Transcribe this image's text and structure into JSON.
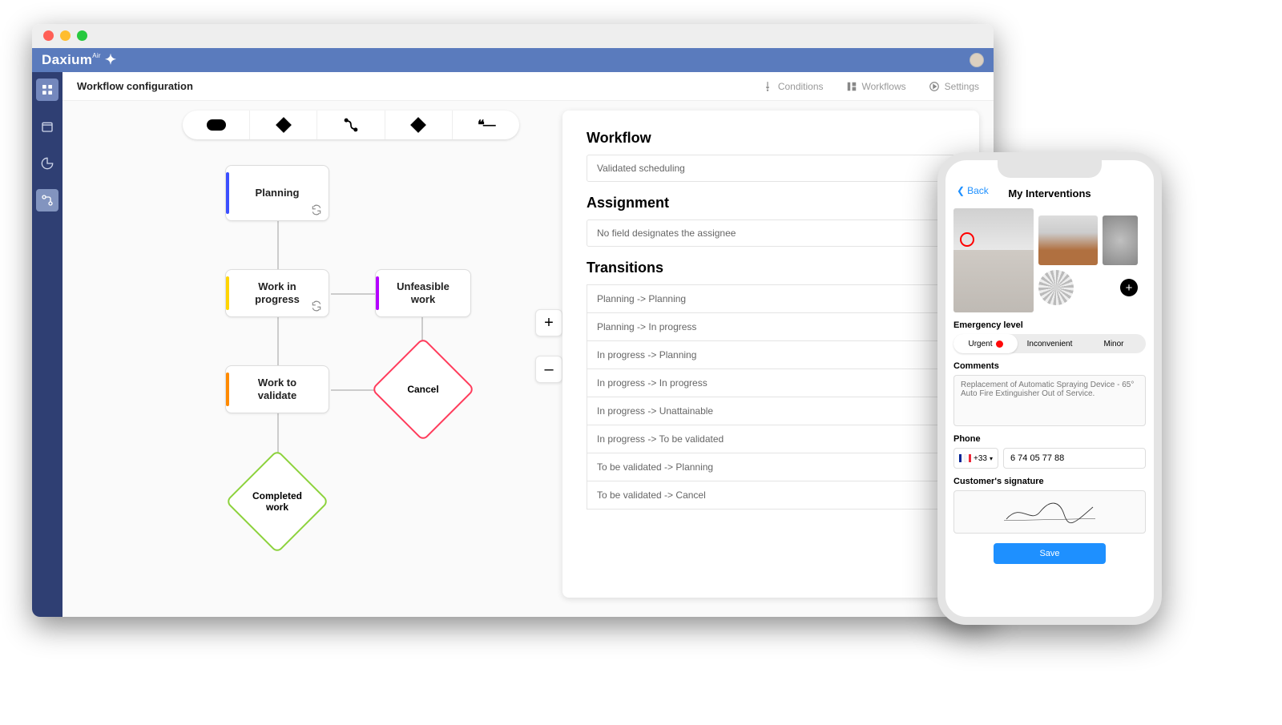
{
  "brand": "Daxium",
  "brand_sup": "Air",
  "header": {
    "breadcrumb": "Workflow configuration",
    "tabs": {
      "conditions": "Conditions",
      "workflows": "Workflows",
      "settings": "Settings"
    }
  },
  "nodes": {
    "planning": "Planning",
    "wip": "Work in\nprogress",
    "unfeasible": "Unfeasible\nwork",
    "validate": "Work to\nvalidate",
    "cancel": "Cancel",
    "completed": "Completed\nwork"
  },
  "panel": {
    "workflow_h": "Workflow",
    "workflow_v": "Validated scheduling",
    "assignment_h": "Assignment",
    "assignment_v": "No field designates the assignee",
    "transitions_h": "Transitions",
    "transitions": [
      "Planning -> Planning",
      "Planning -> In progress",
      "In progress -> Planning",
      "In progress -> In progress",
      "In progress -> Unattainable",
      "In progress -> To be validated",
      "To be validated -> Planning",
      "To be validated -> Cancel"
    ]
  },
  "zoom": {
    "plus": "+",
    "minus": "–"
  },
  "phone": {
    "back": "Back",
    "title": "My Interventions",
    "emergency_h": "Emergency level",
    "seg": {
      "urgent": "Urgent",
      "inconvenient": "Inconvenient",
      "minor": "Minor"
    },
    "comments_h": "Comments",
    "comments": "Replacement of Automatic Spraying Device - 65° Auto Fire Extinguisher Out of Service.",
    "phone_h": "Phone",
    "dial": "+33",
    "number": "6 74 05 77 88",
    "sig_h": "Customer's signature",
    "save": "Save",
    "add": "+"
  }
}
